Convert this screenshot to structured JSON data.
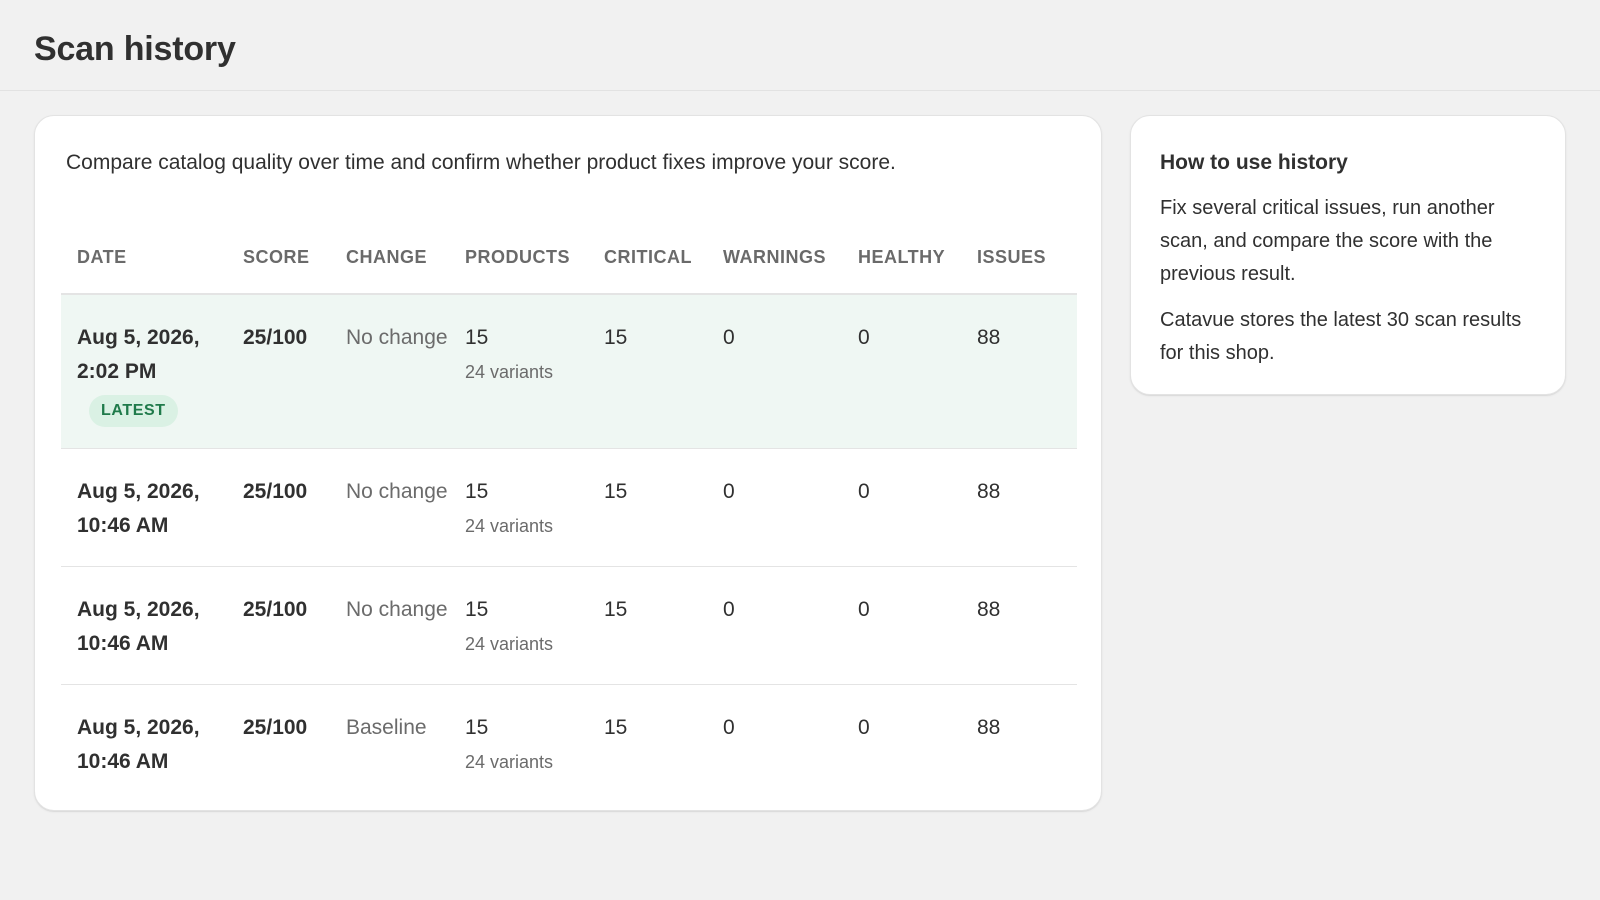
{
  "page": {
    "title": "Scan history"
  },
  "main": {
    "intro": "Compare catalog quality over time and confirm whether product fixes improve your score.",
    "columns": [
      "DATE",
      "SCORE",
      "CHANGE",
      "PRODUCTS",
      "CRITICAL",
      "WARNINGS",
      "HEALTHY",
      "ISSUES"
    ],
    "rows": [
      {
        "date_line1": "Aug 5, 2026,",
        "date_line2": "2:02 PM",
        "badge": "LATEST",
        "score": "25/100",
        "change": "No change",
        "products": "15",
        "variants": "24 variants",
        "critical": "15",
        "warnings": "0",
        "healthy": "0",
        "issues": "88"
      },
      {
        "date_line1": "Aug 5, 2026,",
        "date_line2": "10:46 AM",
        "score": "25/100",
        "change": "No change",
        "products": "15",
        "variants": "24 variants",
        "critical": "15",
        "warnings": "0",
        "healthy": "0",
        "issues": "88"
      },
      {
        "date_line1": "Aug 5, 2026,",
        "date_line2": "10:46 AM",
        "score": "25/100",
        "change": "No change",
        "products": "15",
        "variants": "24 variants",
        "critical": "15",
        "warnings": "0",
        "healthy": "0",
        "issues": "88"
      },
      {
        "date_line1": "Aug 5, 2026,",
        "date_line2": "10:46 AM",
        "score": "25/100",
        "change": "Baseline",
        "products": "15",
        "variants": "24 variants",
        "critical": "15",
        "warnings": "0",
        "healthy": "0",
        "issues": "88"
      }
    ]
  },
  "side": {
    "title": "How to use history",
    "paragraph1": "Fix several critical issues, run another scan, and compare the score with the previous result.",
    "paragraph2": "Catavue stores the latest 30 scan results for this shop."
  },
  "colors": {
    "latest_row_bg": "#eff7f3",
    "badge_bg": "#daf1e4",
    "badge_text": "#1f7a4a"
  }
}
